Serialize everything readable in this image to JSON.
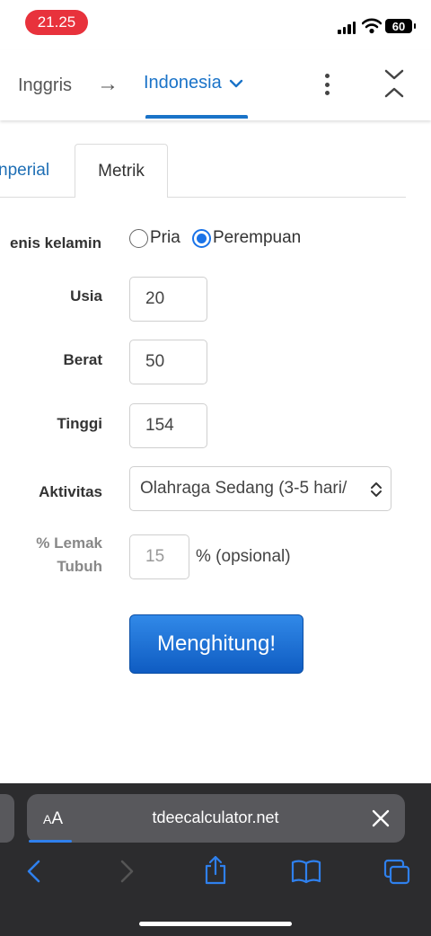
{
  "status_bar": {
    "time": "21.25",
    "battery": "60",
    "icons": [
      "signal-icon",
      "wifi-icon",
      "battery-icon"
    ]
  },
  "translate_bar": {
    "source_language": "Inggris",
    "arrow": "→",
    "target_language": "Indonesia",
    "icons": [
      "dropdown-chevron-icon",
      "more-options-icon",
      "collapse-icon"
    ],
    "accent_color": "#1a73c8"
  },
  "tabs": [
    {
      "label": "nperial",
      "active": false
    },
    {
      "label": "Metrik",
      "active": true
    }
  ],
  "form": {
    "gender": {
      "label": "enis kelamin",
      "options": [
        {
          "label": "Pria",
          "selected": false
        },
        {
          "label": "Perempuan",
          "selected": true
        }
      ]
    },
    "age": {
      "label": "Usia",
      "value": "20"
    },
    "weight": {
      "label": "Berat",
      "value": "50"
    },
    "height": {
      "label": "Tinggi",
      "value": "154"
    },
    "activity": {
      "label": "Aktivitas",
      "value": "Olahraga Sedang (3-5 hari/"
    },
    "body_fat": {
      "label_line1": "% Lemak",
      "label_line2": "Tubuh",
      "placeholder": "15",
      "suffix": "% (opsional)"
    },
    "submit_label": "Menghitung!",
    "button_color": "#1866d0"
  },
  "browser": {
    "text_size_label": "AA",
    "url": "tdeecalculator.net",
    "icons": [
      "close-icon",
      "back-icon",
      "forward-icon",
      "share-icon",
      "bookmarks-icon",
      "tabs-icon"
    ]
  }
}
